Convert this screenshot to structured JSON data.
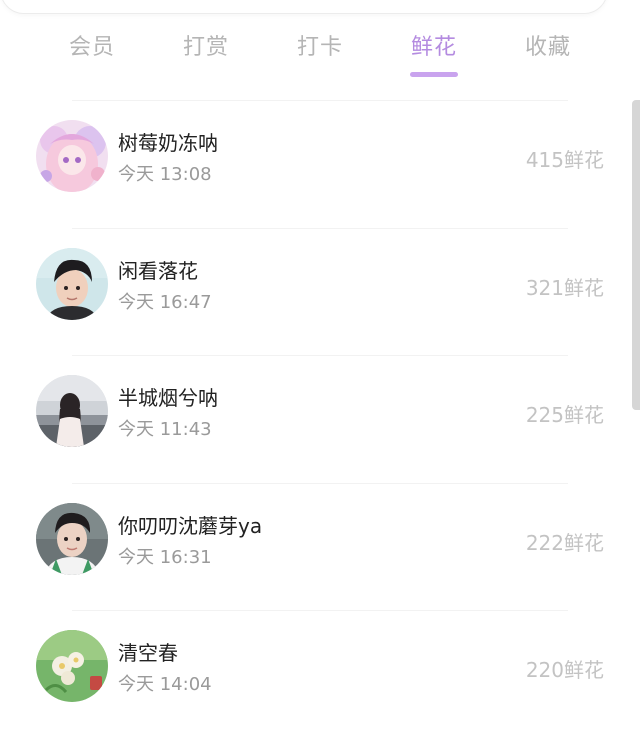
{
  "tabs": [
    {
      "label": "会员",
      "active": false
    },
    {
      "label": "打赏",
      "active": false
    },
    {
      "label": "打卡",
      "active": false
    },
    {
      "label": "鲜花",
      "active": true
    },
    {
      "label": "收藏",
      "active": false
    }
  ],
  "colors": {
    "active_tab": "#b48be0",
    "underline": "#c9a3ee",
    "inactive_tab": "#b5b5b5",
    "name_text": "#222222",
    "time_text": "#9a9a9a",
    "count_text": "#c3c3c3"
  },
  "list": [
    {
      "name": "树莓奶冻呐",
      "time": "今天 13:08",
      "flowers": "415鲜花",
      "avatar_icon": "anime-girl-avatar"
    },
    {
      "name": "闲看落花",
      "time": "今天 16:47",
      "flowers": "321鲜花",
      "avatar_icon": "boy-portrait-avatar"
    },
    {
      "name": "半城烟兮呐",
      "time": "今天 11:43",
      "flowers": "225鲜花",
      "avatar_icon": "girl-back-view-avatar"
    },
    {
      "name": "你叨叨沈蘑芽ya",
      "time": "今天 16:31",
      "flowers": "222鲜花",
      "avatar_icon": "boy-green-shirt-avatar"
    },
    {
      "name": "清空春",
      "time": "今天 14:04",
      "flowers": "220鲜花",
      "avatar_icon": "flowers-green-avatar"
    }
  ]
}
